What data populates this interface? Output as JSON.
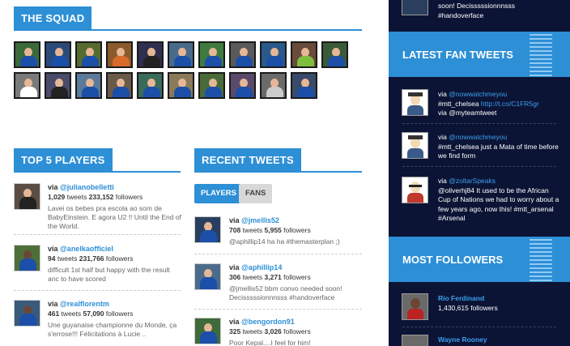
{
  "squad": {
    "title": "THE SQUAD"
  },
  "top_players": {
    "title": "TOP 5 PLAYERS",
    "items": [
      {
        "via": "via",
        "handle": "@julianobelletti",
        "tweets": "1,029",
        "tweets_label": "tweets",
        "followers": "233,152",
        "followers_label": "followers",
        "message": "Lavei os bebes pra escola ao som de BabyEinstein. E agora U2 !! Until the End of the World."
      },
      {
        "via": "via",
        "handle": "@anelkaofficiel",
        "tweets": "94",
        "tweets_label": "tweets",
        "followers": "231,766",
        "followers_label": "followers",
        "message": "difficult 1st half but happy with the result anc to have scored"
      },
      {
        "via": "via",
        "handle": "@realflorentm",
        "tweets": "461",
        "tweets_label": "tweets",
        "followers": "57,090",
        "followers_label": "followers",
        "message": "Une guyanaise championne du Monde, ça s'errose!!! Félicitations à Lucie .."
      }
    ]
  },
  "recent_tweets": {
    "title": "RECENT TWEETS",
    "tab_players": "PLAYERS",
    "tab_fans": "FANS",
    "items": [
      {
        "via": "via",
        "handle": "@jmellis52",
        "tweets": "708",
        "tweets_label": "tweets",
        "followers": "5,955",
        "followers_label": "followers",
        "message": "@aphillip14 ha ha #themasterplan ;)"
      },
      {
        "via": "via",
        "handle": "@aphillip14",
        "tweets": "306",
        "tweets_label": "tweets",
        "followers": "3,271",
        "followers_label": "followers",
        "message": "@jmellis52 bbm convo needed soon! Decisssssionnnsss #handoverface"
      },
      {
        "via": "via",
        "handle": "@bengordon91",
        "tweets": "325",
        "tweets_label": "tweets",
        "followers": "3,026",
        "followers_label": "followers",
        "message": "Poor Kepal....I feel for him!"
      }
    ]
  },
  "right_top": {
    "line1": "soon! Decisssssionnnsss",
    "line2": "#handoverface"
  },
  "latest_fan_tweets": {
    "title": "LATEST FAN TWEETS",
    "items": [
      {
        "via": "via",
        "handle": "@nowwatchmeyou",
        "text": "#mtt_chelsea ",
        "link": "http://t.co/C1FR5gr",
        "text2": "via @myteamtweet"
      },
      {
        "via": "via",
        "handle": "@nowwatchmeyou",
        "text": "#mtt_chelsea just a Mata of time before we find form",
        "link": "",
        "text2": ""
      },
      {
        "via": "via",
        "handle": "@zoltarSpeaks",
        "text": "@oliverhj84 It used to be the African Cup of Nations we had to worry about a few years ago, now this! #mtt_arsenal #Arsenal",
        "link": "",
        "text2": ""
      }
    ]
  },
  "most_followers": {
    "title": "MOST FOLLOWERS",
    "items": [
      {
        "name": "Rio Ferdinand",
        "followers": "1,430,615",
        "followers_label": "followers"
      },
      {
        "name": "Wayne Rooney",
        "followers": "",
        "followers_label": ""
      }
    ]
  },
  "colors": {
    "accent": "#2d8fd6",
    "sidebar": "#0c1435",
    "chelsea_blue": "#1b4fa8"
  }
}
